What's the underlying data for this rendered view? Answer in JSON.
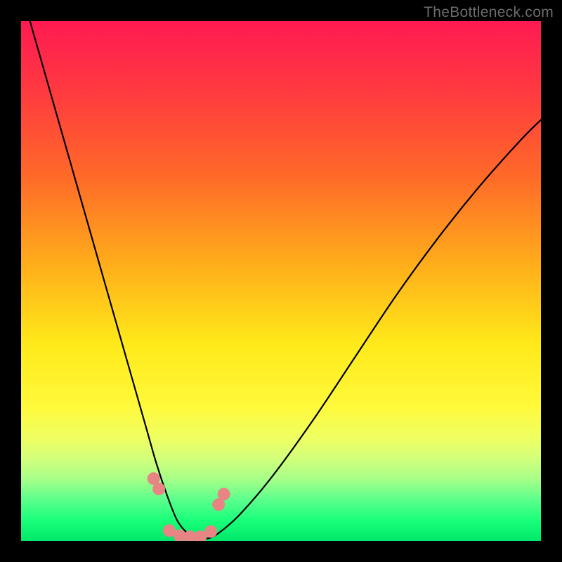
{
  "watermark": "TheBottleneck.com",
  "chart_data": {
    "type": "line",
    "title": "",
    "xlabel": "",
    "ylabel": "",
    "xlim": [
      0,
      100
    ],
    "ylim": [
      0,
      100
    ],
    "series": [
      {
        "name": "bottleneck-curve",
        "x": [
          0,
          4,
          8,
          12,
          16,
          20,
          24,
          26,
          28,
          30,
          32,
          34,
          36,
          38,
          42,
          48,
          56,
          64,
          72,
          80,
          88,
          96,
          100
        ],
        "y": [
          106,
          92,
          78,
          64,
          50,
          36,
          22,
          15,
          9,
          4,
          1.5,
          0.5,
          0.5,
          1.5,
          5,
          12,
          23,
          35,
          47,
          58,
          68,
          77,
          81
        ]
      },
      {
        "name": "marker-dots",
        "x": [
          25.5,
          26.5,
          28.5,
          30.5,
          32.5,
          34.5,
          36.5,
          38.0,
          39.0
        ],
        "y": [
          12,
          10,
          2.0,
          1.0,
          0.8,
          0.8,
          1.8,
          7,
          9
        ]
      }
    ],
    "colors": {
      "curve": "#000000",
      "dots": "#e98484",
      "gradient_top": "#ff1a52",
      "gradient_bottom": "#00e86a"
    }
  }
}
